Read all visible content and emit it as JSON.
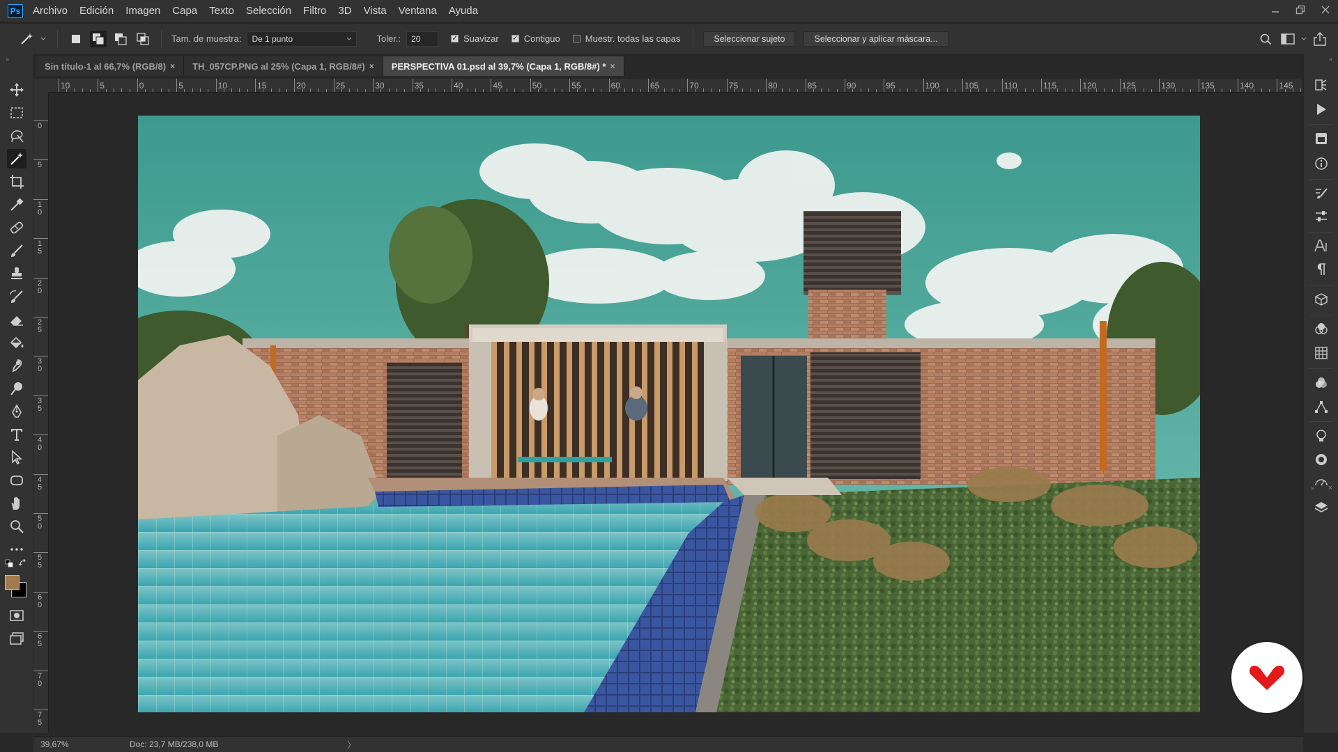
{
  "app": {
    "logo_text": "Ps",
    "menu": [
      "Archivo",
      "Edición",
      "Imagen",
      "Capa",
      "Texto",
      "Selección",
      "Filtro",
      "3D",
      "Vista",
      "Ventana",
      "Ayuda"
    ]
  },
  "options": {
    "sample_size_label": "Tam. de muestra:",
    "sample_size_value": "De 1 punto",
    "tolerance_label": "Toler.:",
    "tolerance_value": "20",
    "antialias_label": "Suavizar",
    "antialias_checked": true,
    "contiguous_label": "Contiguo",
    "contiguous_checked": true,
    "sample_all_label": "Muestr. todas las capas",
    "sample_all_checked": false,
    "select_subject_label": "Seleccionar sujeto",
    "select_mask_label": "Seleccionar y aplicar máscara..."
  },
  "tabs": [
    {
      "label": "Sin título-1 al 66,7% (RGB/8)",
      "active": false
    },
    {
      "label": "TH_057CP.PNG al 25% (Capa 1, RGB/8#)",
      "active": false
    },
    {
      "label": "PERSPECTIVA 01.psd al 39,7% (Capa 1, RGB/8#) *",
      "active": true
    }
  ],
  "tab_close_glyph": "×",
  "ruler": {
    "top_labels": [
      "10",
      "5",
      "0",
      "5",
      "10",
      "15",
      "20",
      "25",
      "30",
      "35",
      "40",
      "45",
      "50",
      "55",
      "60",
      "65",
      "70",
      "75",
      "80",
      "85",
      "90",
      "95",
      "100",
      "105",
      "110",
      "115",
      "120",
      "125",
      "130",
      "135",
      "140",
      "145"
    ],
    "left_labels": [
      "0",
      "5",
      "10",
      "15",
      "20",
      "25",
      "30",
      "35",
      "40",
      "45",
      "50",
      "55",
      "60",
      "65",
      "70",
      "75"
    ]
  },
  "status": {
    "zoom": "39,67%",
    "doc_info": "Doc: 23,7 MB/238,0 MB",
    "arrow": "〉"
  },
  "colors": {
    "foreground": "#a27a4f",
    "background": "#000000",
    "accent": "#31a8ff",
    "brand_red": "#e21a1a"
  },
  "icons": {
    "tools": [
      "move-icon",
      "marquee-icon",
      "lasso-icon",
      "magic-wand-icon",
      "crop-icon",
      "eyedropper-icon",
      "healing-brush-icon",
      "brush-icon",
      "stamp-icon",
      "history-brush-icon",
      "eraser-icon",
      "paint-bucket-icon",
      "smudge-icon",
      "dodge-icon",
      "pen-icon",
      "type-icon",
      "path-select-icon",
      "shape-icon",
      "hand-icon",
      "zoom-icon",
      "more-tools-icon"
    ],
    "dock": [
      "history-icon",
      "actions-icon",
      "libraries-icon",
      "info-icon",
      "brush-settings-icon",
      "adjustments-icon",
      "character-icon",
      "paragraph-icon",
      "3d-icon",
      "channels-icon",
      "grid-icon",
      "swatches-icon",
      "transform-icon",
      "lightbulb-icon",
      "styles-icon",
      "properties-icon",
      "layers-icon"
    ]
  }
}
